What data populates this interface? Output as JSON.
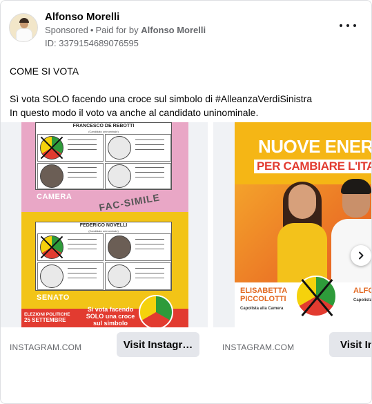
{
  "post": {
    "author": "Alfonso Morelli",
    "sponsored_label": "Sponsored",
    "paid_prefix": "Paid for by",
    "paid_by": "Alfonso Morelli",
    "ad_id": "ID: 337915468907659​5",
    "text_lines": [
      "COME SI VOTA",
      "Sì vota SOLO facendo una croce sul simbolo di #AlleanzaVerdiSinistra",
      "In questo modo il voto va anche al candidato uninominale."
    ]
  },
  "carousel": {
    "cards": [
      {
        "domain": "INSTAGRAM.COM",
        "cta": "Visit Instagr…",
        "art": {
          "ballot1_title": "FRANCESCO DE REBOTTI",
          "ballot1_sub": "(Candidato uninominale)",
          "ballot1_label": "CAMERA",
          "watermark": "FAC-SIMILE",
          "ballot2_title": "FEDERICO NOVELLI",
          "ballot2_sub": "(Candidato uninominale)",
          "ballot2_label": "SENATO",
          "elections": "ELEZIONI POLITICHE",
          "date": "25 SETTEMBRE",
          "instruction": "Si vota facendo SOLO una croce sul simbolo"
        }
      },
      {
        "domain": "INSTAGRAM.COM",
        "cta": "Visit Ins",
        "art": {
          "headline1": "NUOVE ENERGIE",
          "headline2": "PER CAMBIARE L'ITALIA",
          "candidate1": "ELISABETTA PICCOLOTTI",
          "candidate1_role": "Capolista alla Camera",
          "candidate2": "ALFO MOR",
          "candidate2_role": "Capolista"
        }
      }
    ]
  },
  "icons": {
    "more": "more-horizontal-icon",
    "next": "chevron-right-icon"
  }
}
